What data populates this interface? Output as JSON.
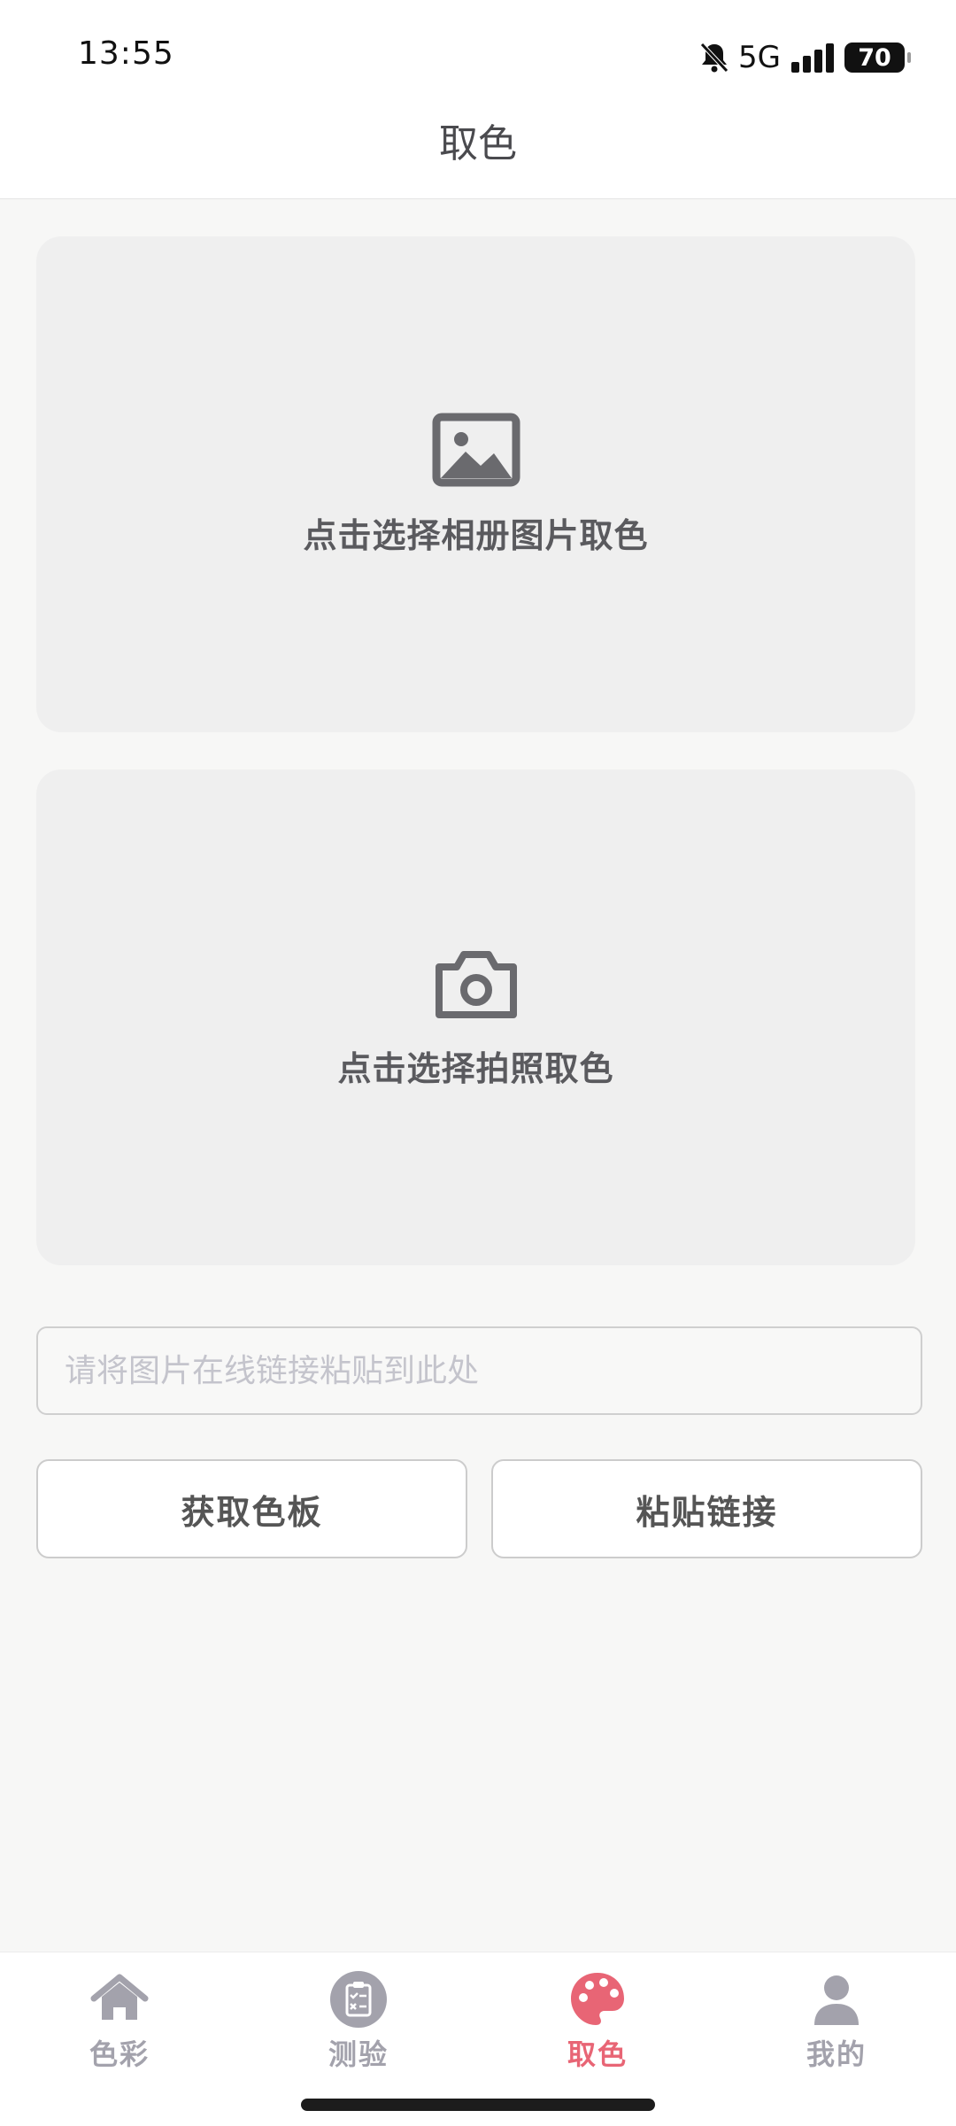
{
  "status_bar": {
    "time": "13:55",
    "network": "5G",
    "battery": "70"
  },
  "header": {
    "title": "取色"
  },
  "cards": [
    {
      "label": "点击选择相册图片取色",
      "icon": "image-icon"
    },
    {
      "label": "点击选择拍照取色",
      "icon": "camera-icon"
    }
  ],
  "url_input": {
    "value": "",
    "placeholder": "请将图片在线链接粘贴到此处"
  },
  "buttons": {
    "get_palette": "获取色板",
    "paste_link": "粘贴链接"
  },
  "tabbar": {
    "items": [
      {
        "label": "色彩",
        "icon": "home-icon"
      },
      {
        "label": "测验",
        "icon": "quiz-icon"
      },
      {
        "label": "取色",
        "icon": "palette-icon",
        "active": true
      },
      {
        "label": "我的",
        "icon": "user-icon"
      }
    ]
  },
  "colors": {
    "active": "#e86575",
    "inactive": "#a3a2ac",
    "card_bg": "#efefef"
  }
}
